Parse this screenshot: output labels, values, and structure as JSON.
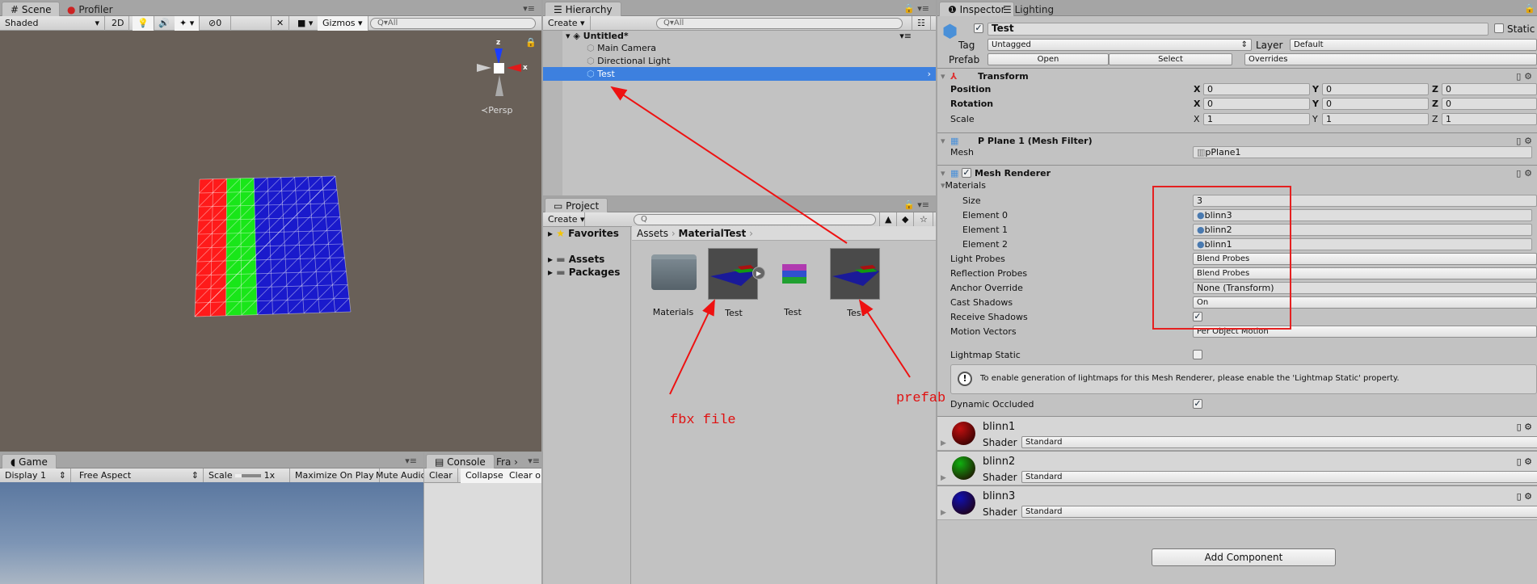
{
  "scene": {
    "tabs": [
      {
        "label": "Scene",
        "icon": "hash-icon"
      },
      {
        "label": "Profiler",
        "icon": "profiler-icon"
      }
    ],
    "toolbar": {
      "shading": "Shaded",
      "mode_2d": "2D",
      "hidden_count": "0",
      "gizmos": "Gizmos",
      "search_placeholder": "All"
    },
    "gizmo": {
      "z_label": "z",
      "x_label": "x",
      "projection": "Persp"
    },
    "mesh_colors": [
      "#ff1a1a",
      "#19e619",
      "#1a1acc"
    ]
  },
  "game": {
    "tab": "Game",
    "toolbar": {
      "display": "Display 1",
      "aspect": "Free Aspect",
      "scale_label": "Scale",
      "scale_value": "1x",
      "maximize": "Maximize On Play",
      "mute": "Mute Audio"
    }
  },
  "console": {
    "tabs": [
      "Console",
      "Fra"
    ],
    "buttons": [
      "Clear",
      "Collapse",
      "Clear o"
    ]
  },
  "hierarchy": {
    "tab": "Hierarchy",
    "create": "Create",
    "search_placeholder": "All",
    "scene_name": "Untitled*",
    "items": [
      {
        "label": "Main Camera"
      },
      {
        "label": "Directional Light"
      },
      {
        "label": "Test",
        "selected": true
      }
    ]
  },
  "project": {
    "tab": "Project",
    "create": "Create",
    "tree": [
      {
        "label": "Favorites",
        "icon": "star-icon"
      },
      {
        "label": "Assets",
        "icon": "folder-icon"
      },
      {
        "label": "Packages",
        "icon": "folder-icon"
      }
    ],
    "breadcrumb": [
      "Assets",
      "MaterialTest"
    ],
    "assets": [
      {
        "label": "Materials",
        "type": "folder"
      },
      {
        "label": "Test",
        "type": "model"
      },
      {
        "label": "Test",
        "type": "archive"
      },
      {
        "label": "Test",
        "type": "prefab"
      }
    ]
  },
  "annotations": {
    "fbx_label": "fbx file",
    "prefab_label": "prefab",
    "color": "#ee1111"
  },
  "inspector": {
    "tabs": [
      {
        "label": "Inspector"
      },
      {
        "label": "Lighting"
      }
    ],
    "object_name": "Test",
    "active": true,
    "static_label": "Static",
    "static": false,
    "tag_label": "Tag",
    "tag": "Untagged",
    "layer_label": "Layer",
    "layer": "Default",
    "prefab_label": "Prefab",
    "prefab_buttons": [
      "Open",
      "Select",
      "Overrides"
    ],
    "transform": {
      "title": "Transform",
      "rows": [
        {
          "label": "Position",
          "x": "0",
          "y": "0",
          "z": "0"
        },
        {
          "label": "Rotation",
          "x": "0",
          "y": "0",
          "z": "0"
        },
        {
          "label": "Scale",
          "x": "1",
          "y": "1",
          "z": "1"
        }
      ]
    },
    "mesh_filter": {
      "title": "P Plane 1 (Mesh Filter)",
      "mesh_label": "Mesh",
      "mesh": "pPlane1"
    },
    "mesh_renderer": {
      "title": "Mesh Renderer",
      "materials_label": "Materials",
      "size_label": "Size",
      "size": "3",
      "elements": [
        {
          "label": "Element 0",
          "value": "blinn3"
        },
        {
          "label": "Element 1",
          "value": "blinn2"
        },
        {
          "label": "Element 2",
          "value": "blinn1"
        }
      ],
      "props": [
        {
          "label": "Light Probes",
          "value": "Blend Probes"
        },
        {
          "label": "Reflection Probes",
          "value": "Blend Probes"
        },
        {
          "label": "Anchor Override",
          "value": "None (Transform)"
        },
        {
          "label": "Cast Shadows",
          "value": "On"
        },
        {
          "label": "Receive Shadows",
          "checked": true
        },
        {
          "label": "Motion Vectors",
          "value": "Per Object Motion"
        }
      ],
      "lightmap_static_label": "Lightmap Static",
      "lightmap_static": false,
      "help": "To enable generation of lightmaps for this Mesh Renderer, please enable the 'Lightmap Static' property.",
      "dynamic_occluded_label": "Dynamic Occluded",
      "dynamic_occluded": true
    },
    "materials": [
      {
        "name": "blinn1",
        "shader_label": "Shader",
        "shader": "Standard",
        "color": "#c01010"
      },
      {
        "name": "blinn2",
        "shader_label": "Shader",
        "shader": "Standard",
        "color": "#10b010"
      },
      {
        "name": "blinn3",
        "shader_label": "Shader",
        "shader": "Standard",
        "color": "#1010b0"
      }
    ],
    "add_component": "Add Component"
  }
}
